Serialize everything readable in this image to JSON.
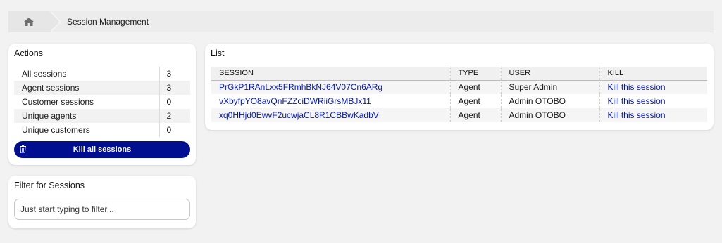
{
  "breadcrumb": {
    "home_icon": "home-icon",
    "current": "Session Management"
  },
  "actions": {
    "title": "Actions",
    "stats": [
      {
        "label": "All sessions",
        "value": "3"
      },
      {
        "label": "Agent sessions",
        "value": "3"
      },
      {
        "label": "Customer sessions",
        "value": "0"
      },
      {
        "label": "Unique agents",
        "value": "2"
      },
      {
        "label": "Unique customers",
        "value": "0"
      }
    ],
    "kill_all_label": "Kill all sessions",
    "kill_all_icon": "trash-icon",
    "button_color": "#000f8f"
  },
  "filter": {
    "title": "Filter for Sessions",
    "placeholder": "Just start typing to filter..."
  },
  "list": {
    "title": "List",
    "columns": [
      "SESSION",
      "TYPE",
      "USER",
      "KILL"
    ],
    "rows": [
      {
        "session": "PrGkP1RAnLxx5FRmhBkNJ64V07Cn6ARg",
        "type": "Agent",
        "user": "Super Admin",
        "kill": "Kill this session"
      },
      {
        "session": "vXbyfpYO8avQnFZZciDWRiiGrsMBJx11",
        "type": "Agent",
        "user": "Admin OTOBO",
        "kill": "Kill this session"
      },
      {
        "session": "xq0HHjd0EwvF2ucwjaCL8R1CBBwKadbV",
        "type": "Agent",
        "user": "Admin OTOBO",
        "kill": "Kill this session"
      }
    ],
    "link_color": "#0015c6"
  }
}
